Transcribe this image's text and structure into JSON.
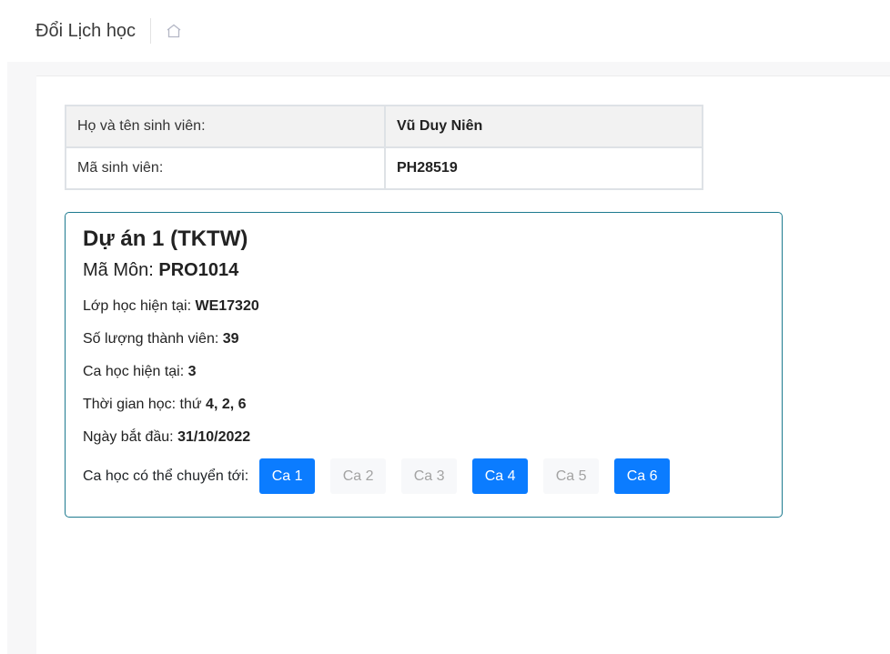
{
  "header": {
    "title": "Đổi Lịch học"
  },
  "student": {
    "name_label": "Họ và tên sinh viên:",
    "name_value": "Vũ Duy Niên",
    "id_label": "Mã sinh viên:",
    "id_value": "PH28519"
  },
  "course": {
    "name": "Dự án 1 (TKTW)",
    "code_label": "Mã Môn: ",
    "code_value": "PRO1014",
    "class_label": "Lớp học hiện tại: ",
    "class_value": "WE17320",
    "members_label": "Số lượng thành viên: ",
    "members_value": "39",
    "shift_label": "Ca học hiện tại: ",
    "shift_value": "3",
    "schedule_label": "Thời gian học: thứ ",
    "schedule_value": "4, 2, 6",
    "start_label": "Ngày bắt đầu: ",
    "start_value": "31/10/2022",
    "switch_label": "Ca học có thể chuyển tới:",
    "shifts": [
      {
        "label": "Ca 1",
        "available": true
      },
      {
        "label": "Ca 2",
        "available": false
      },
      {
        "label": "Ca 3",
        "available": false
      },
      {
        "label": "Ca 4",
        "available": true
      },
      {
        "label": "Ca 5",
        "available": false
      },
      {
        "label": "Ca 6",
        "available": true
      }
    ]
  },
  "colors": {
    "accent": "#0b7cff",
    "card_border": "#1d7a8f",
    "disabled_bg": "#f7f8fa"
  },
  "icons": {
    "home": "home-icon"
  }
}
